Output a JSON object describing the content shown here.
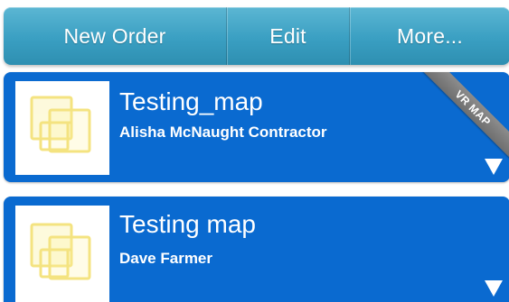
{
  "toolbar": {
    "new_order_label": "New Order",
    "edit_label": "Edit",
    "more_label": "More..."
  },
  "orders": [
    {
      "title": "Testing_map",
      "subtitle": "Alisha McNaught Contractor",
      "ribbon": "VR MAP",
      "thumbnail_icon": "map-layers-icon",
      "expand_icon": "triangle-down-icon"
    },
    {
      "title": "Testing map",
      "subtitle": "Dave Farmer",
      "thumbnail_icon": "map-layers-icon",
      "expand_icon": "triangle-down-icon"
    }
  ],
  "colors": {
    "toolbar": "#3a9fc2",
    "card": "#0a6ad0",
    "ribbon": "#7d7d7d",
    "thumbnail_outline": "#f4e27a"
  }
}
